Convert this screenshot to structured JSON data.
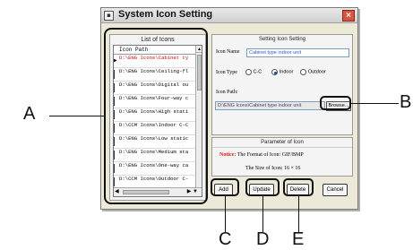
{
  "window": {
    "title": "System Icon Setting",
    "app_icon": "system-menu-icon",
    "close_label": "×"
  },
  "list_panel": {
    "title": "List of Icons",
    "header": "Icon Path",
    "items": [
      {
        "label": "D:\\ENG Icons\\Cabinet ty",
        "selected": true
      },
      {
        "label": "D:\\ENG Icons\\Ceiling-fl",
        "selected": false
      },
      {
        "label": "D:\\ENG Icons\\Digital ou",
        "selected": false
      },
      {
        "label": "D:\\ENG Icons\\Four-way c",
        "selected": false
      },
      {
        "label": "D:\\ENG Icons\\High stati",
        "selected": false
      },
      {
        "label": "D:\\CCM Icons\\Indoor C-C",
        "selected": false
      },
      {
        "label": "D:\\ENG Icons\\Low static",
        "selected": false
      },
      {
        "label": "D:\\ENG Icons\\Medium sta",
        "selected": false
      },
      {
        "label": "D:\\ENG Icons\\One-way ca",
        "selected": false
      },
      {
        "label": "D:\\CCM Icons\\Outdoor C-",
        "selected": false
      },
      {
        "label": "D:\\ENG Icons\\Split Thin",
        "selected": false
      }
    ]
  },
  "settings": {
    "title": "Setting Icon Setting",
    "icon_name_label": "Icon Name",
    "icon_name_value": "Cabinet type indoor unit",
    "icon_type_label": "Icon Type",
    "icon_type_options": [
      "C-C",
      "Indoor",
      "Outdoor"
    ],
    "icon_type_selected": "Indoor",
    "icon_path_label": "Icon Path:",
    "icon_path_value": "D:\\ENG Icons\\Cabinet type indoor unit",
    "browse_label": "Browse..."
  },
  "parameters": {
    "title": "Parameter of Icon",
    "notice_label": "Notice:",
    "format_text": "The Format of Icon:  GIF/BMP",
    "size_text": "The Size of Icon:  16 × 16"
  },
  "actions": {
    "add": "Add",
    "update": "Update",
    "delete": "Delete",
    "cancel": "Cancel"
  },
  "annotations": {
    "a": "A",
    "b": "B",
    "c": "C",
    "d": "D",
    "e": "E"
  }
}
